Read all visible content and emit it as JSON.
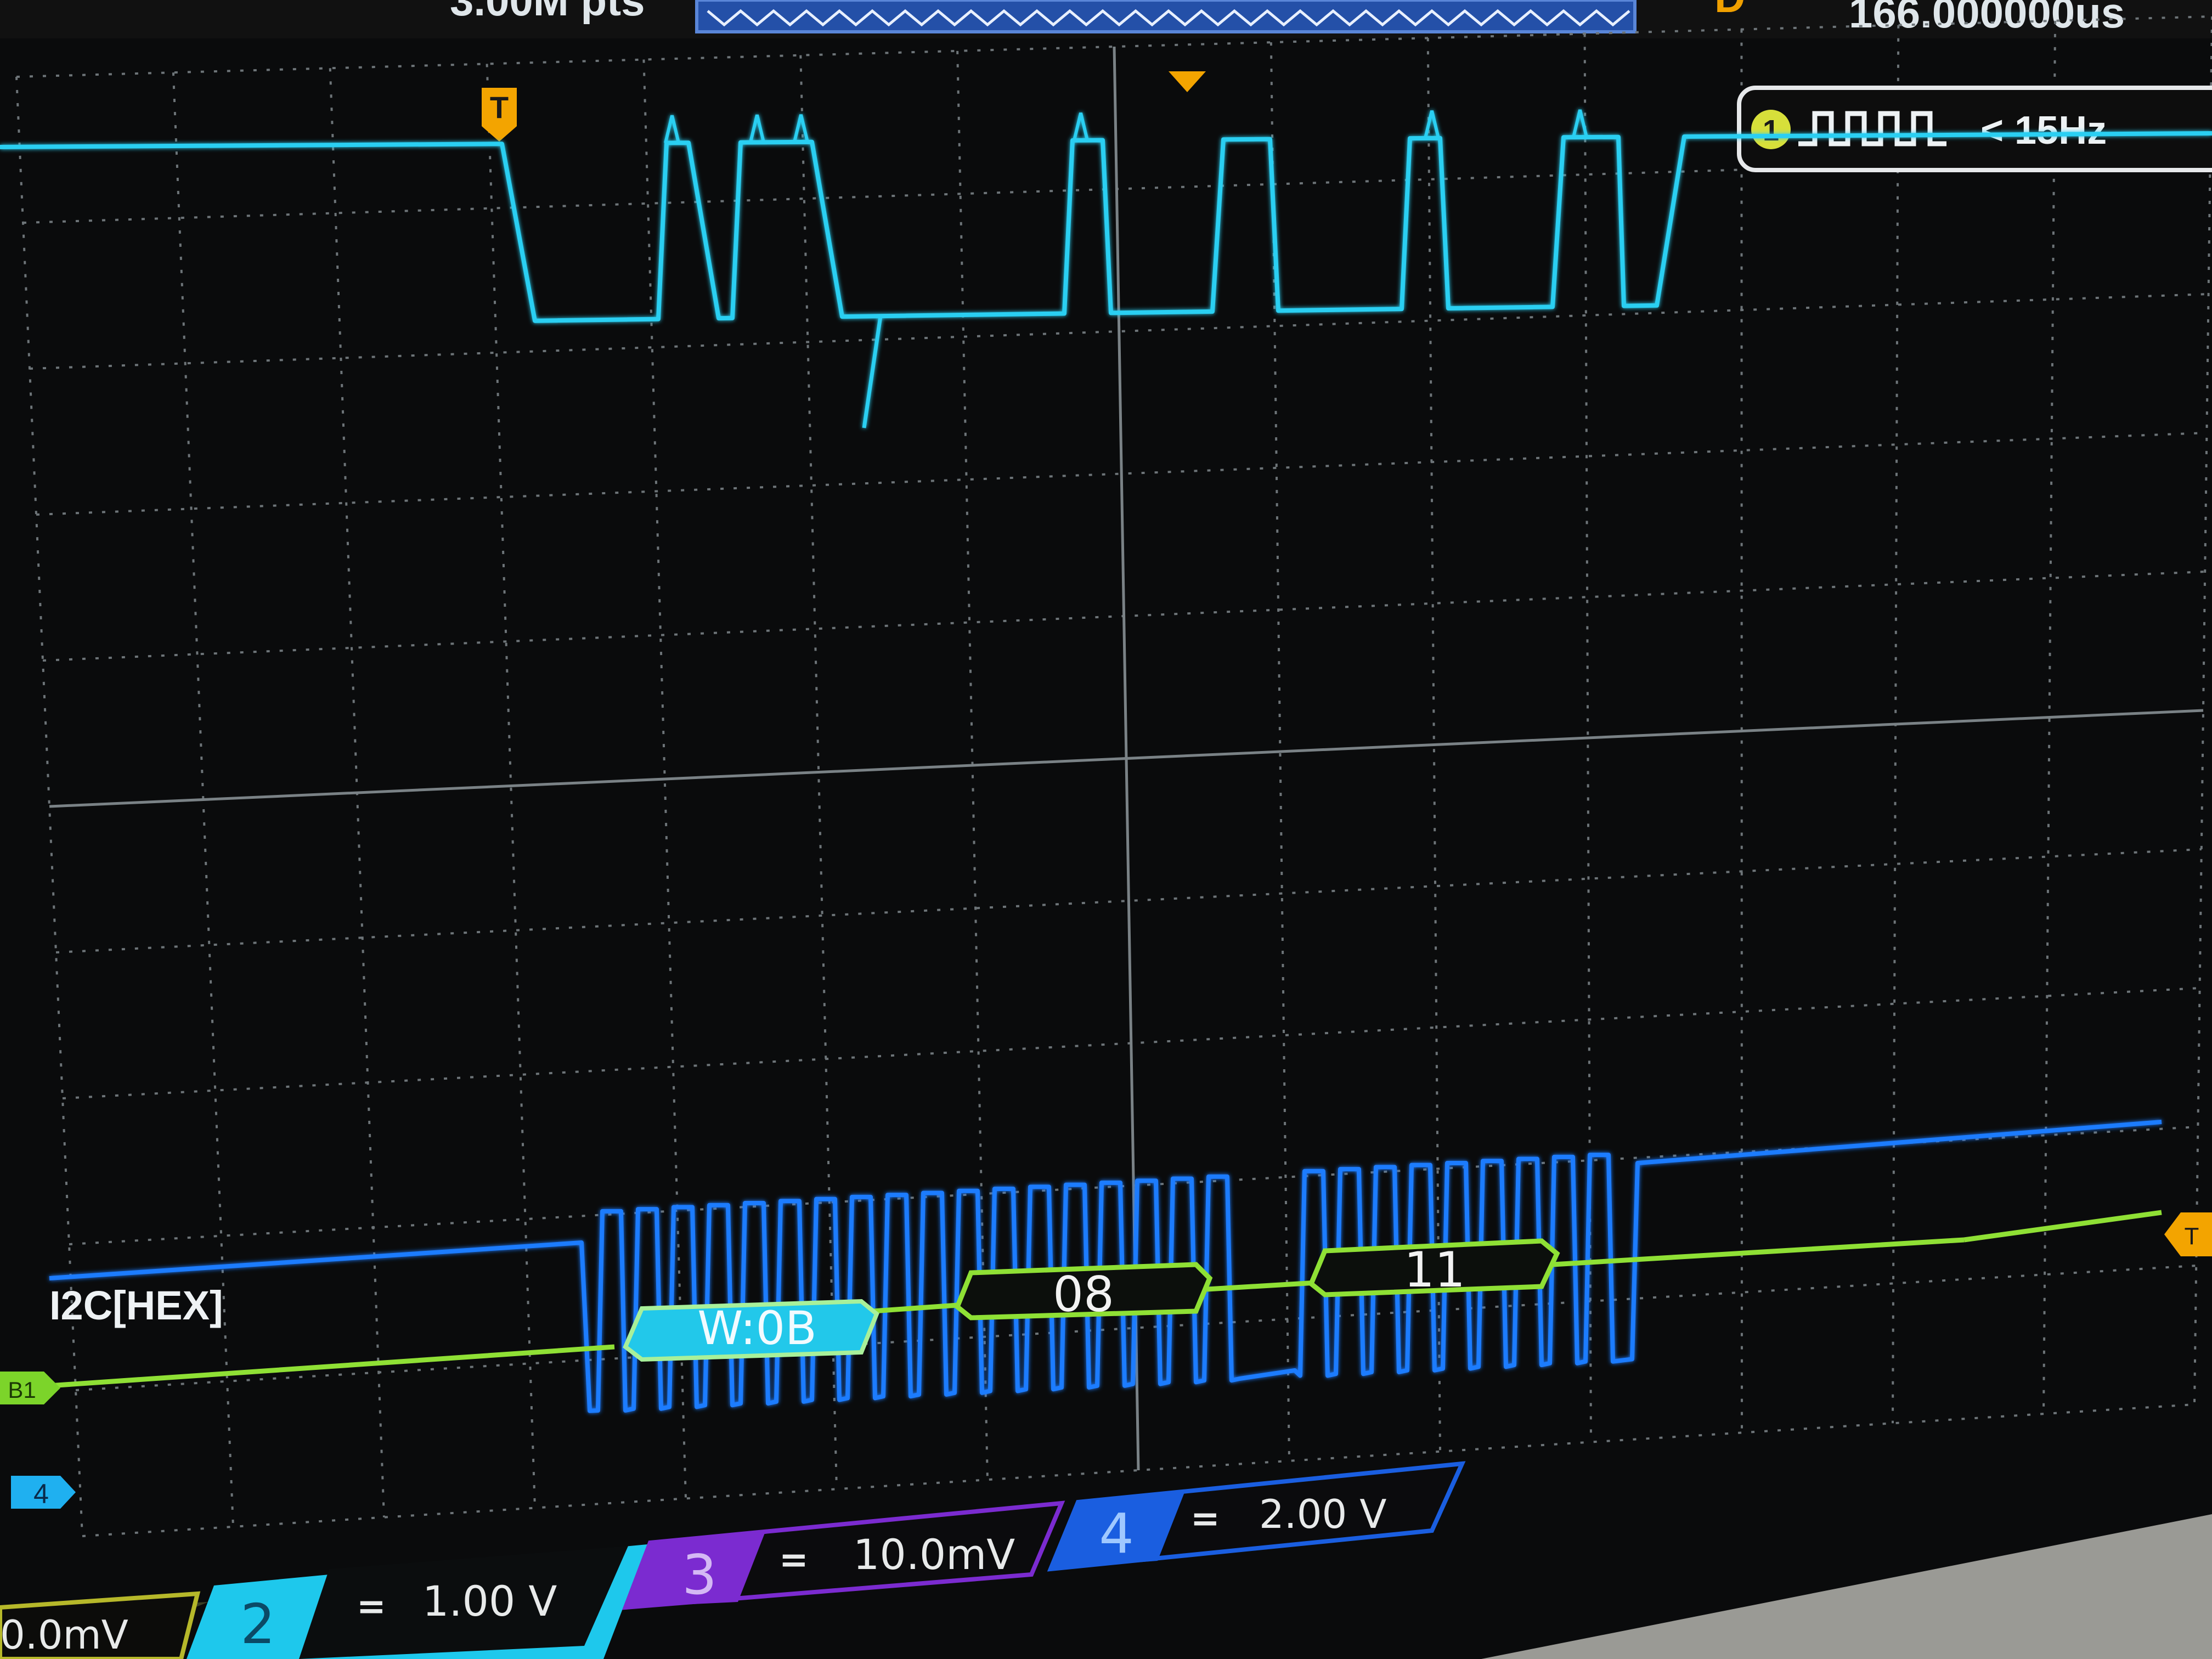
{
  "topbar": {
    "sample_rate": "3.00M pts",
    "delay_letter": "D",
    "delay_value": "166.000000us"
  },
  "trigger_panel": {
    "channel": "1",
    "frequency": "< 15Hz"
  },
  "markers": {
    "trigger_pos": "T",
    "channel4_marker": "4",
    "bus_marker": "B1",
    "trigger_level": "T"
  },
  "decoder": {
    "label": "I2C[HEX]",
    "packets": [
      {
        "text": "W:0B",
        "kind": "address"
      },
      {
        "text": "08",
        "kind": "data"
      },
      {
        "text": "11",
        "kind": "data"
      }
    ]
  },
  "channels": [
    {
      "id": "ch1",
      "scale": "0.0mV",
      "color": "#c9d02a"
    },
    {
      "id": "ch2",
      "num": "2",
      "coupling": "=",
      "scale": "1.00 V",
      "color": "#1ed0f0"
    },
    {
      "id": "ch3",
      "num": "3",
      "coupling": "=",
      "scale": "10.0mV",
      "color": "#8a2bd6"
    },
    {
      "id": "ch4",
      "num": "4",
      "coupling": "=",
      "scale": "2.00 V",
      "color": "#1a64ff"
    }
  ],
  "colors": {
    "ch2_trace": "#29cff2",
    "ch4_trace": "#1f7cff",
    "bus_line": "#9be03a",
    "grid": "#6d7478"
  }
}
